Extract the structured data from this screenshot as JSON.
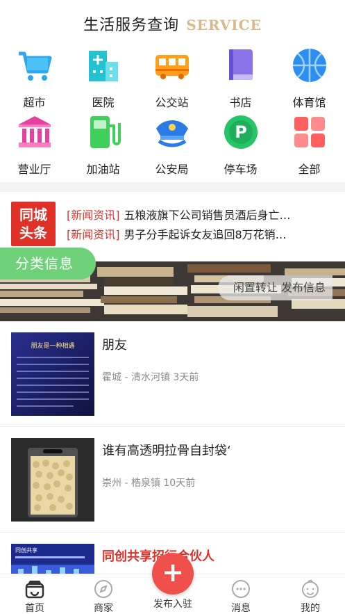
{
  "header": {
    "title": "生活服务查询",
    "subtitle": "SERVICE"
  },
  "services": [
    {
      "label": "超市",
      "icon": "shopping-cart-icon",
      "color": "#2fa8f0"
    },
    {
      "label": "医院",
      "icon": "hospital-icon",
      "color": "#22c2d3"
    },
    {
      "label": "公交站",
      "icon": "bus-icon",
      "color": "#ff9f1a"
    },
    {
      "label": "书店",
      "icon": "book-icon",
      "color": "#8a72e8"
    },
    {
      "label": "体育馆",
      "icon": "basketball-icon",
      "color": "#2d8ef0"
    },
    {
      "label": "营业厅",
      "icon": "bank-building-icon",
      "color": "#e93fa0"
    },
    {
      "label": "加油站",
      "icon": "gas-pump-icon",
      "color": "#3fcf5a"
    },
    {
      "label": "公安局",
      "icon": "police-hat-icon",
      "color": "#2a7be8"
    },
    {
      "label": "停车场",
      "icon": "parking-icon",
      "color": "#25c466"
    },
    {
      "label": "全部",
      "icon": "grid-icon",
      "color": "#ff6161"
    }
  ],
  "news": {
    "logo_line1": "同城",
    "logo_line2": "头条",
    "items": [
      {
        "tag": "[新闻资讯]",
        "text": "五粮液旗下公司销售员酒后身亡…"
      },
      {
        "tag": "[新闻资讯]",
        "text": "男子分手起诉女友追回8万花销…"
      }
    ]
  },
  "category": {
    "tab_label": "分类信息",
    "banner_text": "闲置转让 发布信息"
  },
  "listings": [
    {
      "title": "朋友",
      "meta": "霍城 - 清水河镇 3天前",
      "thumb_text": "朋友是一种相遇"
    },
    {
      "title": "谁有高透明拉骨自封袋‘",
      "meta": "崇州 - 梏泉镇 10天前",
      "thumb_text": ""
    },
    {
      "title": "同创共享招行合伙人",
      "meta": "",
      "thumb_text": "同创共享"
    }
  ],
  "tabbar": {
    "home": "首页",
    "merchant": "商家",
    "publish": "发布入驻",
    "messages": "消息",
    "mine": "我的"
  }
}
